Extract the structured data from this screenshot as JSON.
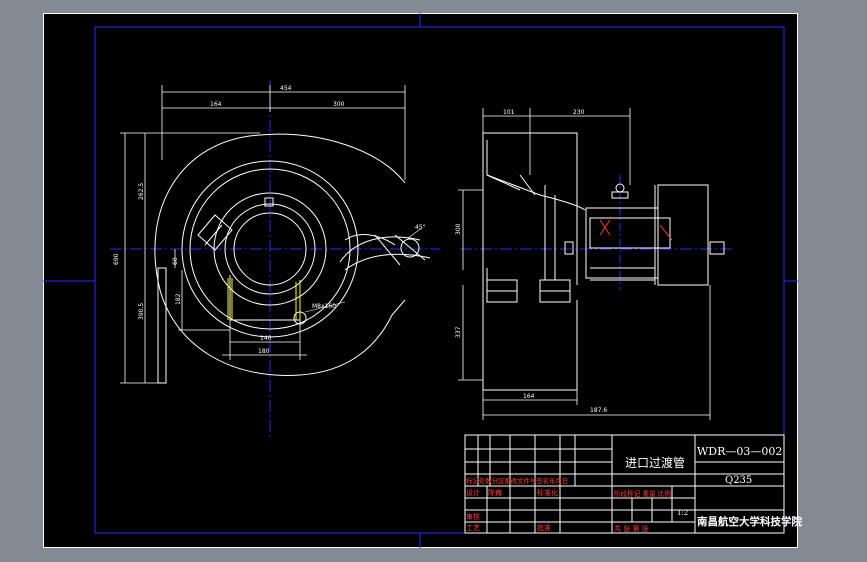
{
  "dimensions": {
    "front_top_overall": "454",
    "front_top_left": "164",
    "front_top_right": "300",
    "front_left_height": "690",
    "front_left_upper": "262.5",
    "front_left_lower": "390.5",
    "front_inner_small": "60",
    "front_inner_mid": "182",
    "front_bottom_inner": "140",
    "front_bottom_outer": "180",
    "front_flange_label": "M8x160",
    "front_angle": "45°",
    "side_top_left": "101",
    "side_top_right": "230",
    "side_upper_height": "300",
    "side_lower_height": "337",
    "side_bottom_inner": "164",
    "side_bottom_overall": "187.6"
  },
  "title_block": {
    "part_name": "进口过渡管",
    "drawing_no": "WDR—03—002",
    "material": "Q235",
    "scale": "1:2",
    "school": "南昌航空大学科技学院",
    "rev_header": "标记处数分区更改文件号签名年月日",
    "design_label": "设计",
    "design_name": "陈巍",
    "standard_label": "标准化",
    "stage_label": "阶段标记 重量 比例",
    "review_label": "审核",
    "process_label": "工艺",
    "approve_label": "批准",
    "sheet_label": "共 张 第 张"
  },
  "colors": {
    "sheet": "#000000",
    "geometry": "#ffffff",
    "frame": "#0000ff",
    "center": "#0000ff",
    "dimension": "#ffffff",
    "weld": "#ffff00",
    "hatch": "#ff3b3b",
    "highlight": "#66ff66"
  }
}
